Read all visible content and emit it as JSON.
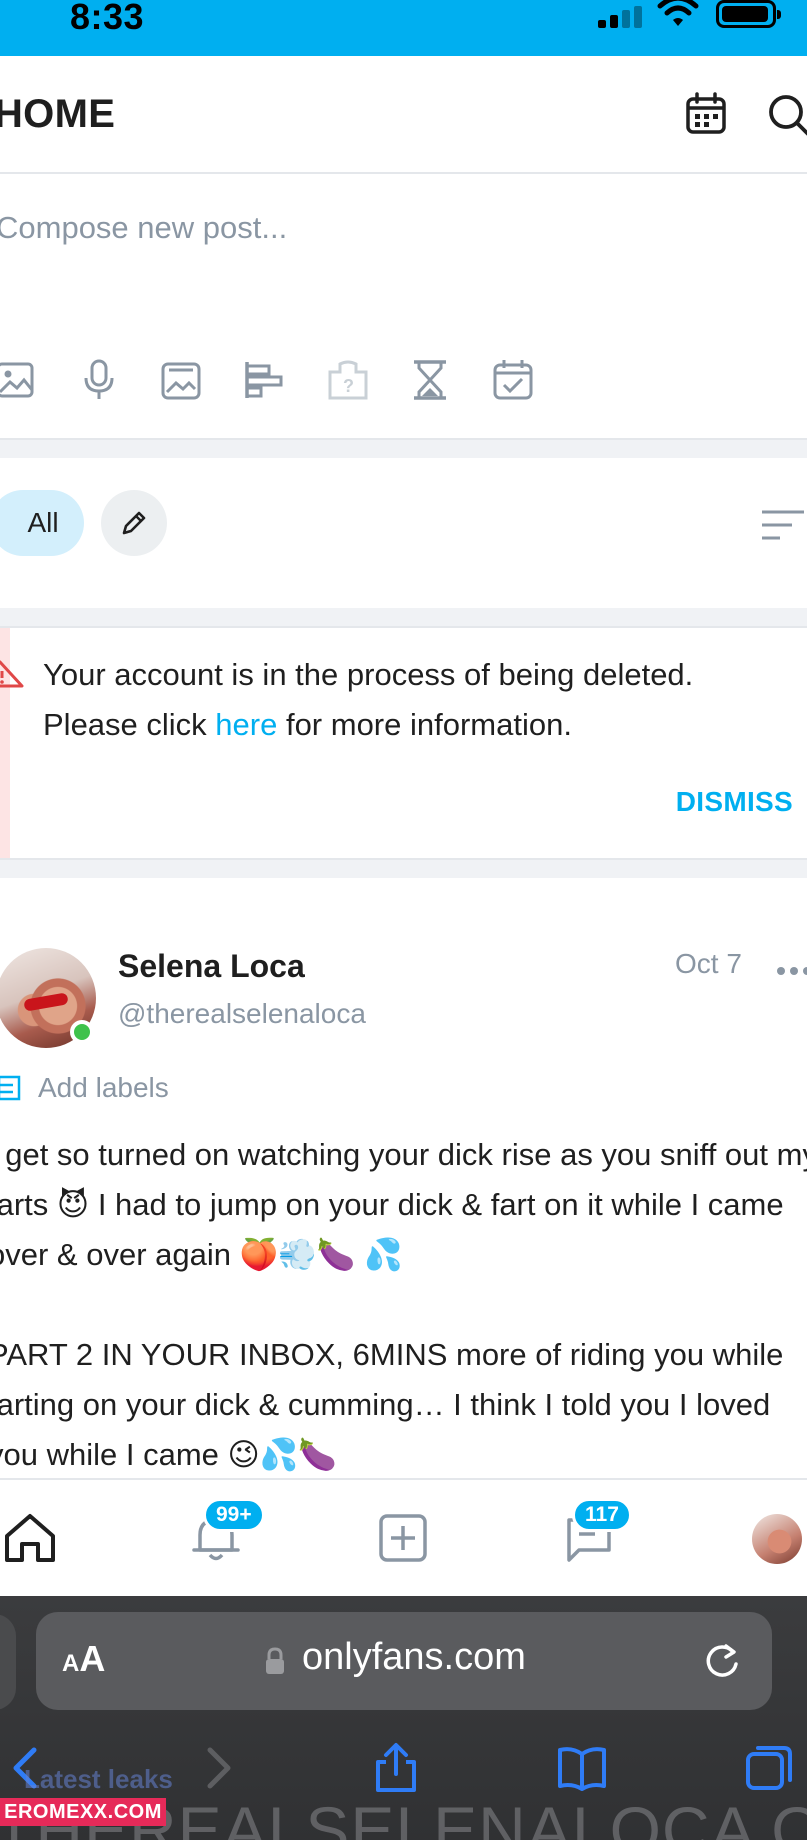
{
  "status_bar": {
    "time": "8:33"
  },
  "header": {
    "title": "HOME",
    "icons": [
      "calendar-icon",
      "search-icon"
    ]
  },
  "compose": {
    "placeholder": "Compose new post...",
    "tools": [
      "image-icon",
      "microphone-icon",
      "gallery-icon",
      "poll-icon",
      "quiz-icon",
      "hourglass-icon",
      "schedule-icon"
    ]
  },
  "filters": {
    "all_label": "All",
    "icons": [
      "pencil-icon",
      "sort-icon"
    ]
  },
  "alert": {
    "line1": "Your account is in the process of being deleted.",
    "line2_before": "Please click ",
    "link": "here",
    "line2_after": " for more information.",
    "dismiss": "DISMISS"
  },
  "post": {
    "name": "Selena Loca",
    "handle": "@therealselenaloca",
    "date": "Oct 7",
    "add_labels": "Add labels",
    "text": "I get so turned on watching your dick rise as you sniff out my farts 😈 I had to jump on your dick & fart on it while I came over & over again 🍑💨🍆 💦\n\nPART 2 IN YOUR INBOX, 6MINS more of riding you while farting on your dick & cumming… I think I told you I loved you while I came 😉💦🍆"
  },
  "tabbar": {
    "notifications_badge": "99+",
    "messages_badge": "117",
    "icons": [
      "home-icon",
      "bell-icon",
      "add-post-icon",
      "messages-icon"
    ]
  },
  "browser": {
    "aa_label_small": "A",
    "aa_label": "A",
    "url": "onlyfans.com",
    "watermark_label": "Latest leaks",
    "watermark": "THEREALSELENALOCA O",
    "site_badge": "EROMEXX.COM"
  },
  "colors": {
    "brand": "#00aff0",
    "danger": "#e04848",
    "online": "#3fc24b",
    "muted": "#8a96a3"
  }
}
